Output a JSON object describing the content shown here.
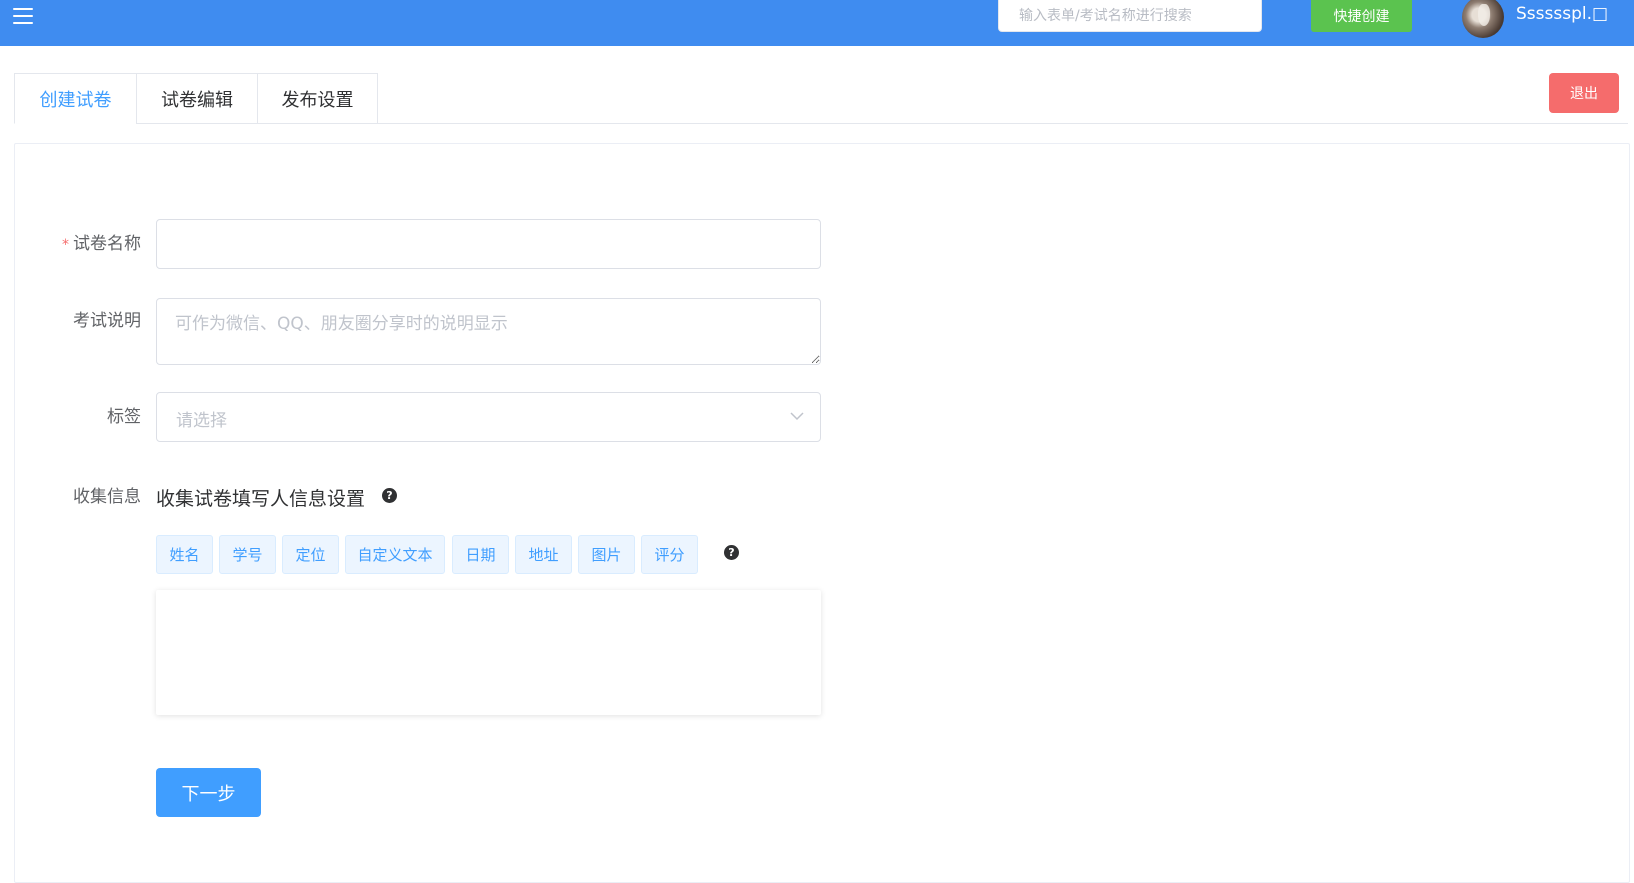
{
  "header": {
    "search_placeholder": "输入表单/考试名称进行搜索",
    "quick_create_label": "快捷创建",
    "username": "Sssssspl.□"
  },
  "tabs": [
    {
      "label": "创建试卷",
      "active": true
    },
    {
      "label": "试卷编辑",
      "active": false
    },
    {
      "label": "发布设置",
      "active": false
    }
  ],
  "exit_label": "退出",
  "form": {
    "name_label": "试卷名称",
    "name_value": "",
    "desc_label": "考试说明",
    "desc_placeholder": "可作为微信、QQ、朋友圈分享时的说明显示",
    "tag_label": "标签",
    "tag_placeholder": "请选择",
    "collect_label": "收集信息",
    "collect_title": "收集试卷填写人信息设置",
    "collect_tags": [
      "姓名",
      "学号",
      "定位",
      "自定义文本",
      "日期",
      "地址",
      "图片",
      "评分"
    ],
    "next_label": "下一步"
  },
  "colors": {
    "header_bg": "#3f8cf0",
    "quick_create": "#5bc34f",
    "exit": "#f56c6c",
    "primary": "#409eff"
  },
  "icons": {
    "menu": "hamburger-menu-icon",
    "help": "question-circle-icon",
    "dropdown": "chevron-down-icon"
  }
}
